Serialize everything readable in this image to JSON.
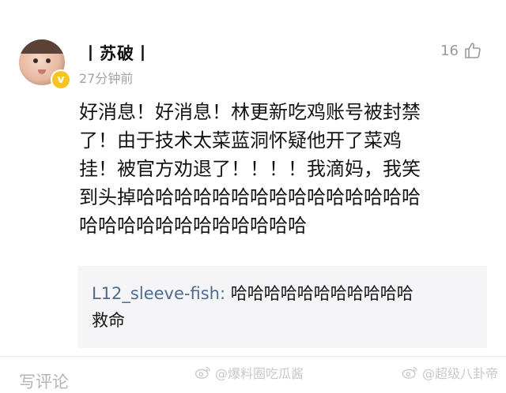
{
  "comment": {
    "username": "丨苏破丨",
    "timestamp": "27分钟前",
    "like_count": "16",
    "body": "好消息！好消息！林更新吃鸡账号被封禁\n了！由于技术太菜蓝洞怀疑他开了菜鸡\n挂！被官方劝退了！！！！我滴妈，我笑\n到头掉哈哈哈哈哈哈哈哈哈哈哈哈哈哈哈\n哈哈哈哈哈哈哈哈哈哈哈哈"
  },
  "reply": {
    "author": "L12_sleeve-fish:",
    "text": " 哈哈哈哈哈哈哈哈哈哈哈\n救命"
  },
  "footer": {
    "write_comment": "写评论",
    "watermark_1": "@爆料圈吃瓜酱",
    "watermark_2": "@超级八卦帝"
  },
  "colors": {
    "verify_badge": "#f7c51e",
    "reply_author": "#4d6c8f",
    "quote_bg": "#f5f5f7"
  }
}
